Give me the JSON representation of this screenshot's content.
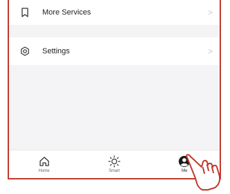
{
  "list": {
    "items": [
      {
        "label": "More Services",
        "icon": "bookmark-icon"
      },
      {
        "label": "Settings",
        "icon": "settings-gear-icon"
      }
    ],
    "chevron": ">"
  },
  "tabbar": {
    "tabs": [
      {
        "label": "Home",
        "icon": "home-icon",
        "active": false
      },
      {
        "label": "Smart",
        "icon": "sun-icon",
        "active": false
      },
      {
        "label": "Me",
        "icon": "profile-icon",
        "active": true
      }
    ]
  },
  "colors": {
    "frame_border": "#c0392b",
    "background": "#f4f4f6",
    "pointer": "#c0392b"
  }
}
